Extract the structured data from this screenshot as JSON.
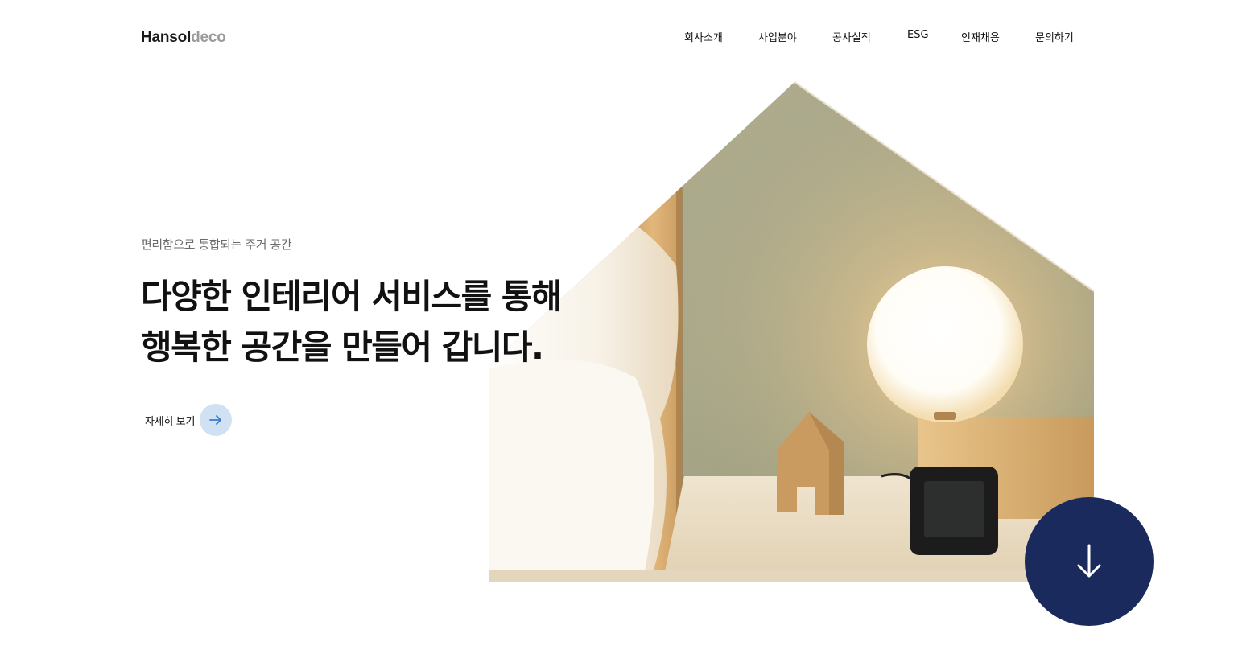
{
  "header": {
    "logo_primary": "Hansol",
    "logo_secondary": "deco",
    "nav": [
      {
        "label": "회사소개"
      },
      {
        "label": "사업분야"
      },
      {
        "label": "공사실적"
      },
      {
        "label": "ESG"
      },
      {
        "label": "인재채용"
      },
      {
        "label": "문의하기"
      }
    ]
  },
  "hero": {
    "subtitle": "편리함으로 통합되는 주거 공간",
    "headline_line1": "다양한 인테리어 서비스를 통해",
    "headline_line2": "행복한 공간을 만들어 갑니다.",
    "more_label": "자세히 보기",
    "more_icon": "arrow-right-icon",
    "image_icon": "house-shaped-lamp-photo"
  },
  "scroll_button": {
    "icon": "arrow-down-icon"
  },
  "colors": {
    "accent_navy": "#1b2a5c",
    "link_circle": "#cfe1f3",
    "link_arrow": "#3a7bc8",
    "subtitle_gray": "#6b6b6b",
    "logo_gray": "#9a9a9a"
  }
}
